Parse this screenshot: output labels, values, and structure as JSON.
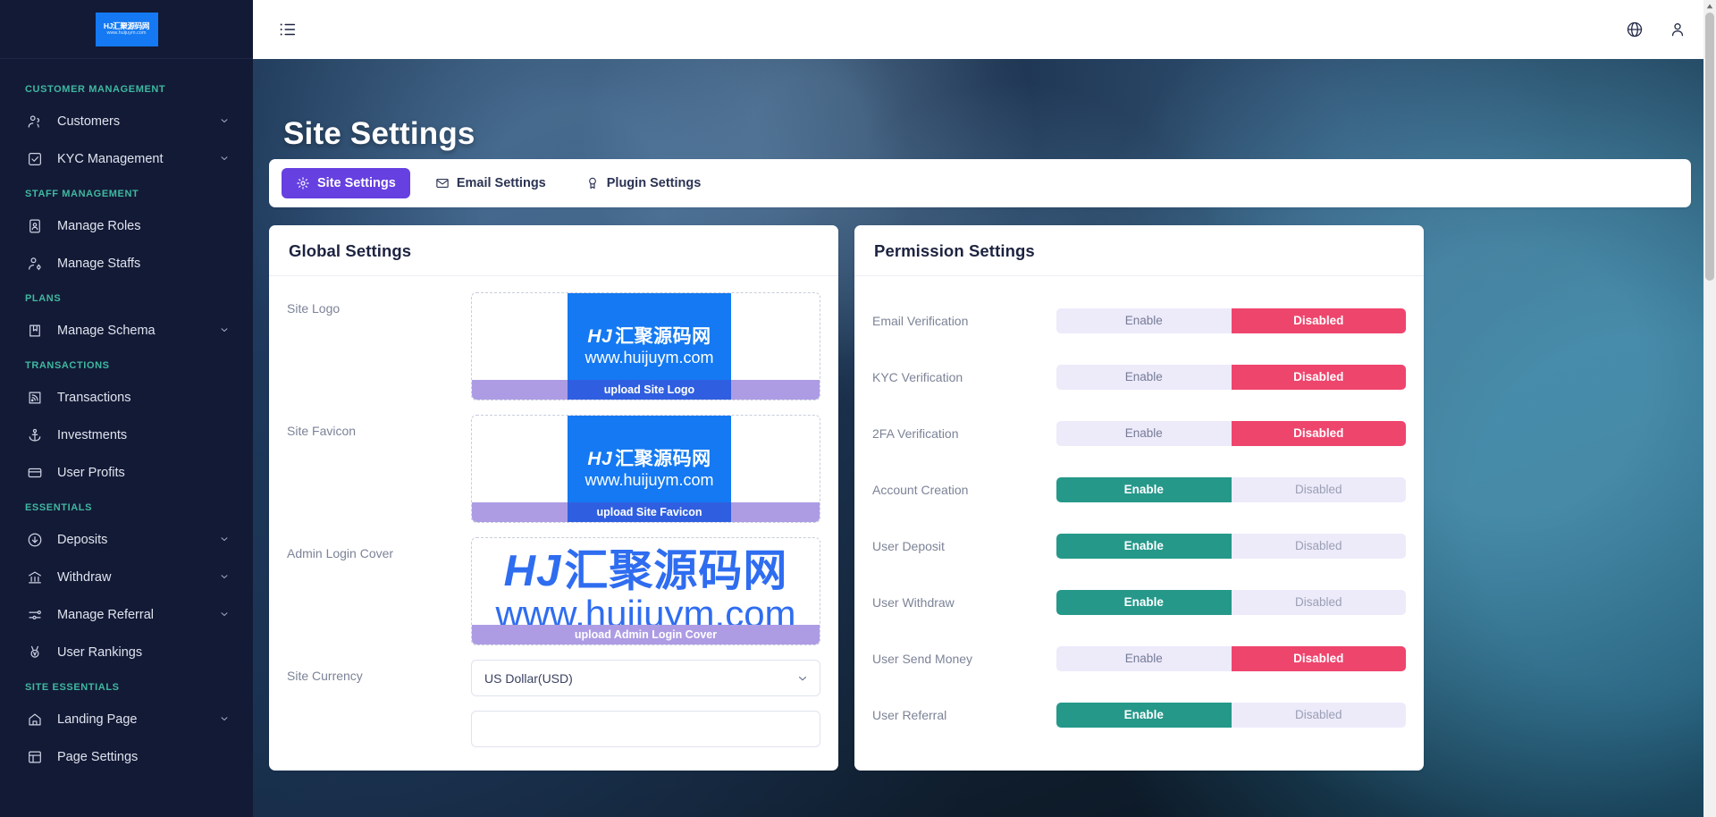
{
  "brand": {
    "logo_line1": "HJ汇聚源码网",
    "logo_line2": "www.huijuym.com",
    "logo_hj": "HJ",
    "logo_cn": "汇聚源码网",
    "logo_url": "www.huijuym.com"
  },
  "sidebar": {
    "sections": [
      {
        "title": "CUSTOMER MANAGEMENT",
        "items": [
          {
            "label": "Customers",
            "icon": "users-icon",
            "caret": true
          },
          {
            "label": "KYC Management",
            "icon": "check-square-icon",
            "caret": true
          }
        ]
      },
      {
        "title": "STAFF MANAGEMENT",
        "items": [
          {
            "label": "Manage Roles",
            "icon": "id-badge-icon",
            "caret": false
          },
          {
            "label": "Manage Staffs",
            "icon": "user-gear-icon",
            "caret": false
          }
        ]
      },
      {
        "title": "PLANS",
        "items": [
          {
            "label": "Manage Schema",
            "icon": "book-bookmark-icon",
            "caret": true
          }
        ]
      },
      {
        "title": "TRANSACTIONS",
        "items": [
          {
            "label": "Transactions",
            "icon": "rss-square-icon",
            "caret": false
          },
          {
            "label": "Investments",
            "icon": "anchor-icon",
            "caret": false
          },
          {
            "label": "User Profits",
            "icon": "credit-card-icon",
            "caret": false
          }
        ]
      },
      {
        "title": "ESSENTIALS",
        "items": [
          {
            "label": "Deposits",
            "icon": "arrow-down-circle-icon",
            "caret": true
          },
          {
            "label": "Withdraw",
            "icon": "bank-icon",
            "caret": true
          },
          {
            "label": "Manage Referral",
            "icon": "sliders-icon",
            "caret": true
          },
          {
            "label": "User Rankings",
            "icon": "medal-icon",
            "caret": false
          }
        ]
      },
      {
        "title": "SITE ESSENTIALS",
        "items": [
          {
            "label": "Landing Page",
            "icon": "home-icon",
            "caret": true
          },
          {
            "label": "Page Settings",
            "icon": "layout-icon",
            "caret": false
          }
        ]
      }
    ]
  },
  "topbar": {
    "menu_icon": "hamburger-list-icon",
    "language_icon": "globe-icon",
    "profile_icon": "user-icon"
  },
  "header": {
    "title": "Site Settings"
  },
  "tabs": [
    {
      "label": "Site Settings",
      "icon": "gear-icon",
      "active": true
    },
    {
      "label": "Email Settings",
      "icon": "envelope-icon",
      "active": false
    },
    {
      "label": "Plugin Settings",
      "icon": "award-ribbon-icon",
      "active": false
    }
  ],
  "global_settings": {
    "title": "Global Settings",
    "rows": [
      {
        "label": "Site Logo",
        "upload_label": "upload Site Logo",
        "type": "image-small"
      },
      {
        "label": "Site Favicon",
        "upload_label": "upload Site Favicon",
        "type": "image-small"
      },
      {
        "label": "Admin Login Cover",
        "upload_label": "upload Admin Login Cover",
        "type": "image-wide"
      }
    ],
    "currency": {
      "label": "Site Currency",
      "value": "US Dollar(USD)",
      "caret_icon": "chevron-down-icon"
    }
  },
  "permission_settings": {
    "title": "Permission Settings",
    "enable_label": "Enable",
    "disabled_label": "Disabled",
    "rows": [
      {
        "label": "Email Verification",
        "state": "disabled"
      },
      {
        "label": "KYC Verification",
        "state": "disabled"
      },
      {
        "label": "2FA Verification",
        "state": "disabled"
      },
      {
        "label": "Account Creation",
        "state": "enabled"
      },
      {
        "label": "User Deposit",
        "state": "enabled"
      },
      {
        "label": "User Withdraw",
        "state": "enabled"
      },
      {
        "label": "User Send Money",
        "state": "disabled"
      },
      {
        "label": "User Referral",
        "state": "enabled"
      }
    ]
  },
  "colors": {
    "sidebar_bg": "#131a36",
    "section_label": "#3fb8a0",
    "tab_active": "#6640e0",
    "enabled_green": "#25988a",
    "disabled_red": "#ee456d",
    "toggle_idle": "#edeafa",
    "upload_purple": "#ad9ce4",
    "logo_blue": "#1479f2"
  }
}
